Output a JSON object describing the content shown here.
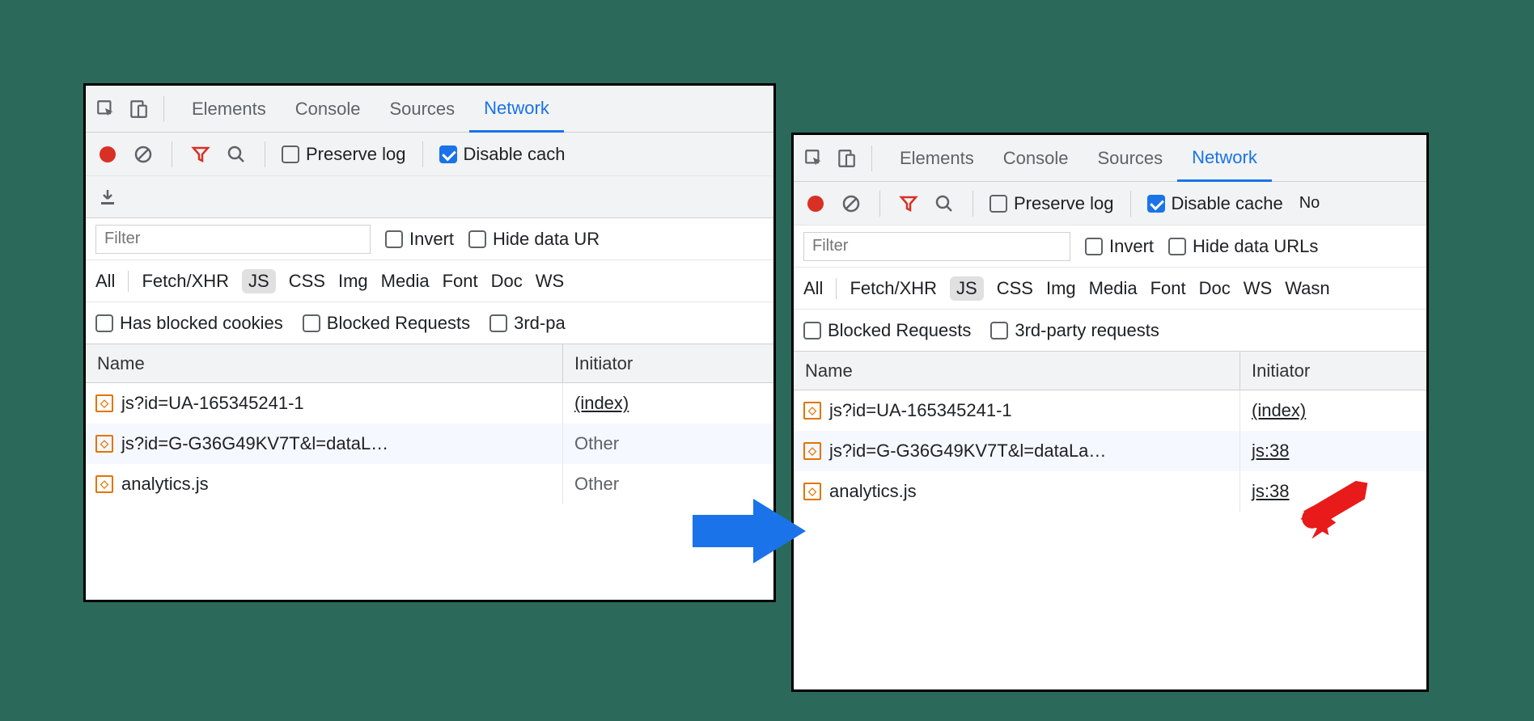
{
  "tabs": {
    "elements": "Elements",
    "console": "Console",
    "sources": "Sources",
    "network": "Network"
  },
  "toolbar": {
    "preserve_log": "Preserve log",
    "disable_cache": "Disable cache",
    "disable_cache_cut": "Disable cach",
    "no_label": "No"
  },
  "filter": {
    "placeholder": "Filter",
    "invert": "Invert",
    "hide_urls_cut_left": "Hide data UR",
    "hide_urls_right": "Hide data URLs"
  },
  "types": {
    "all": "All",
    "fetch": "Fetch/XHR",
    "js": "JS",
    "css": "CSS",
    "img": "Img",
    "media": "Media",
    "font": "Font",
    "doc": "Doc",
    "ws": "WS",
    "wasm": "Wasn"
  },
  "extra_filters": {
    "blocked_cookies": "Has blocked cookies",
    "blocked_requests": "Blocked Requests",
    "third_party_cut": "3rd-pa",
    "third_party": "3rd-party requests"
  },
  "columns": {
    "name": "Name",
    "initiator": "Initiator"
  },
  "left_rows": [
    {
      "name": "js?id=UA-165345241-1",
      "initiator": "(index)",
      "linked": true
    },
    {
      "name": "js?id=G-G36G49KV7T&l=dataL…",
      "initiator": "Other",
      "linked": false
    },
    {
      "name": "analytics.js",
      "initiator": "Other",
      "linked": false
    }
  ],
  "right_rows": [
    {
      "name": "js?id=UA-165345241-1",
      "initiator": "(index)",
      "linked": true
    },
    {
      "name": "js?id=G-G36G49KV7T&l=dataLa…",
      "initiator": "js:38",
      "linked": true
    },
    {
      "name": "analytics.js",
      "initiator": "js:38",
      "linked": true
    }
  ]
}
